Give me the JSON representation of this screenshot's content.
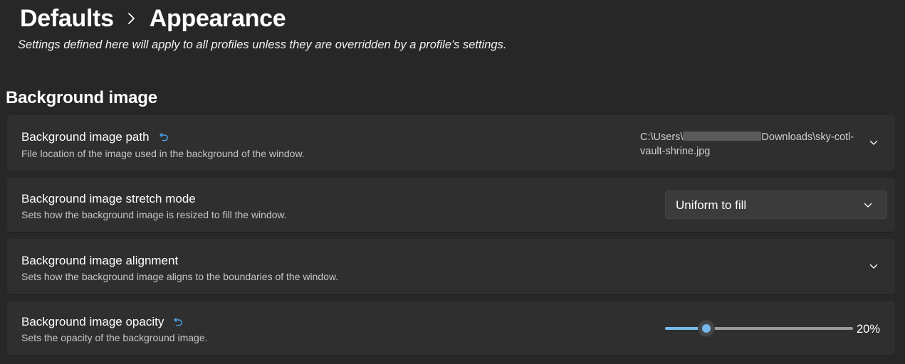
{
  "header": {
    "crumb_root": "Defaults",
    "crumb_current": "Appearance",
    "subtitle": "Settings defined here will apply to all profiles unless they are overridden by a profile's settings."
  },
  "section": {
    "title": "Background image"
  },
  "settings": {
    "path": {
      "title": "Background image path",
      "description": "File location of the image used in the background of the window.",
      "value_prefix": "C:\\Users\\",
      "value_suffix": "Downloads\\sky-cotl-vault-shrine.jpg"
    },
    "stretch": {
      "title": "Background image stretch mode",
      "description": "Sets how the background image is resized to fill the window.",
      "selected": "Uniform to fill"
    },
    "alignment": {
      "title": "Background image alignment",
      "description": "Sets how the background image aligns to the boundaries of the window."
    },
    "opacity": {
      "title": "Background image opacity",
      "description": "Sets the opacity of the background image.",
      "value_label": "20%",
      "value_fraction": 0.22
    }
  },
  "colors": {
    "background": "#272727",
    "card": "#2f2f2f",
    "accent": "#76b9ed",
    "reset_icon": "#4aa3e8"
  },
  "icons": {
    "breadcrumb_separator": "chevron-right-icon",
    "reset": "undo-icon",
    "expand": "chevron-down-icon"
  }
}
